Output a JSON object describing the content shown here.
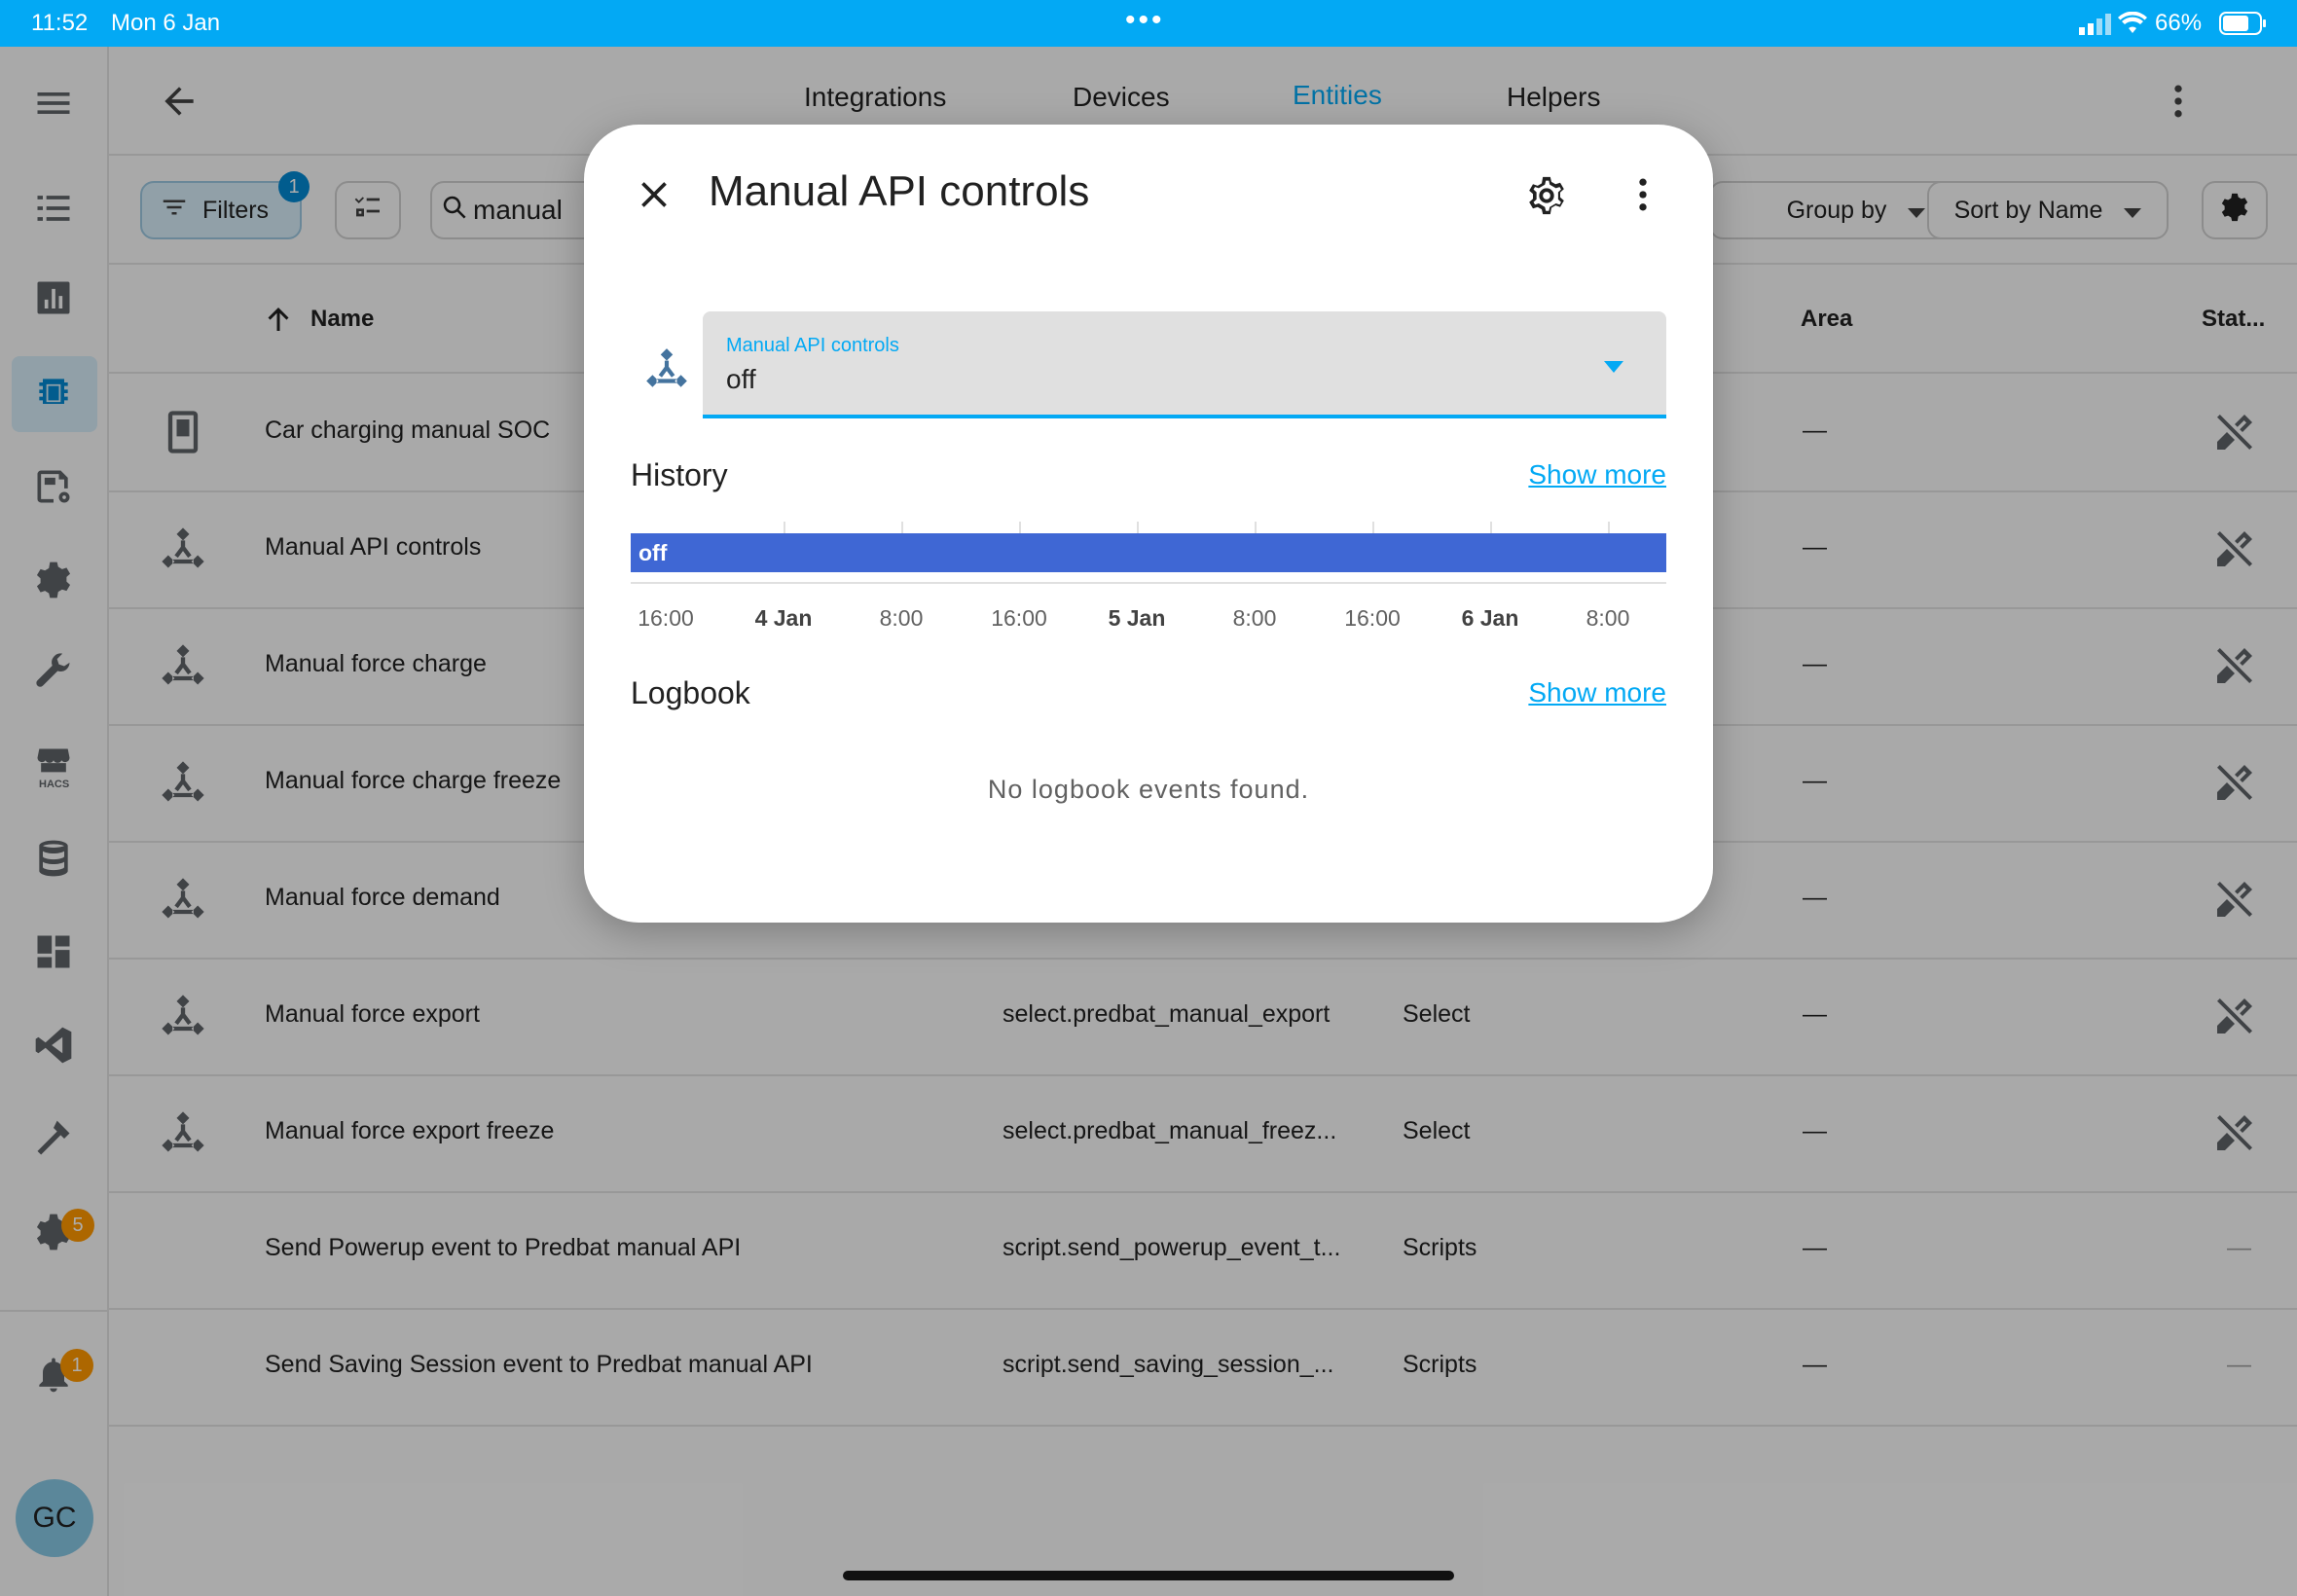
{
  "status_bar": {
    "time": "11:52",
    "date": "Mon 6 Jan",
    "battery": "66%"
  },
  "tabs": [
    {
      "label": "Integrations",
      "active": false
    },
    {
      "label": "Devices",
      "active": false
    },
    {
      "label": "Entities",
      "active": true
    },
    {
      "label": "Helpers",
      "active": false
    }
  ],
  "sidebar": {
    "hacs_label": "HACS",
    "settings_badge": "5",
    "notifications_badge": "1",
    "avatar_initials": "GC"
  },
  "toolbar": {
    "filters_label": "Filters",
    "filters_badge": "1",
    "search_value": "manual",
    "group_by_label": "Group by",
    "sort_label": "Sort by Name"
  },
  "table": {
    "headers": {
      "name": "Name",
      "area": "Area",
      "status": "Stat..."
    },
    "rows": [
      {
        "icon": "counter-icon",
        "name": "Car charging manual SOC",
        "entity_id": "",
        "integration": "",
        "area": "—",
        "status": "unavailable"
      },
      {
        "icon": "select-icon",
        "name": "Manual API controls",
        "entity_id": "",
        "integration": "",
        "area": "—",
        "status": "unavailable"
      },
      {
        "icon": "select-icon",
        "name": "Manual force charge",
        "entity_id": "",
        "integration": "",
        "area": "—",
        "status": "unavailable"
      },
      {
        "icon": "select-icon",
        "name": "Manual force charge freeze",
        "entity_id": "",
        "integration": "",
        "area": "—",
        "status": "unavailable"
      },
      {
        "icon": "select-icon",
        "name": "Manual force demand",
        "entity_id": "",
        "integration": "",
        "area": "—",
        "status": "unavailable"
      },
      {
        "icon": "select-icon",
        "name": "Manual force export",
        "entity_id": "select.predbat_manual_export",
        "integration": "Select",
        "area": "—",
        "status": "unavailable"
      },
      {
        "icon": "select-icon",
        "name": "Manual force export freeze",
        "entity_id": "select.predbat_manual_freez...",
        "integration": "Select",
        "area": "—",
        "status": "unavailable"
      },
      {
        "icon": "",
        "name": "Send Powerup event to Predbat manual API",
        "entity_id": "script.send_powerup_event_t...",
        "integration": "Scripts",
        "area": "—",
        "status": "—"
      },
      {
        "icon": "",
        "name": "Send Saving Session event to Predbat manual API",
        "entity_id": "script.send_saving_session_...",
        "integration": "Scripts",
        "area": "—",
        "status": "—"
      }
    ]
  },
  "dialog": {
    "title": "Manual API controls",
    "select_label": "Manual API controls",
    "select_value": "off",
    "history_title": "History",
    "history_show_more": "Show more",
    "history_state": "off",
    "history_color": "#3f67d4",
    "history_ticks": [
      {
        "label": "16:00",
        "bold": false
      },
      {
        "label": "4 Jan",
        "bold": true
      },
      {
        "label": "8:00",
        "bold": false
      },
      {
        "label": "16:00",
        "bold": false
      },
      {
        "label": "5 Jan",
        "bold": true
      },
      {
        "label": "8:00",
        "bold": false
      },
      {
        "label": "16:00",
        "bold": false
      },
      {
        "label": "6 Jan",
        "bold": true
      },
      {
        "label": "8:00",
        "bold": false
      }
    ],
    "logbook_title": "Logbook",
    "logbook_show_more": "Show more",
    "logbook_empty": "No logbook events found."
  },
  "colors": {
    "accent": "#03a9f4"
  }
}
